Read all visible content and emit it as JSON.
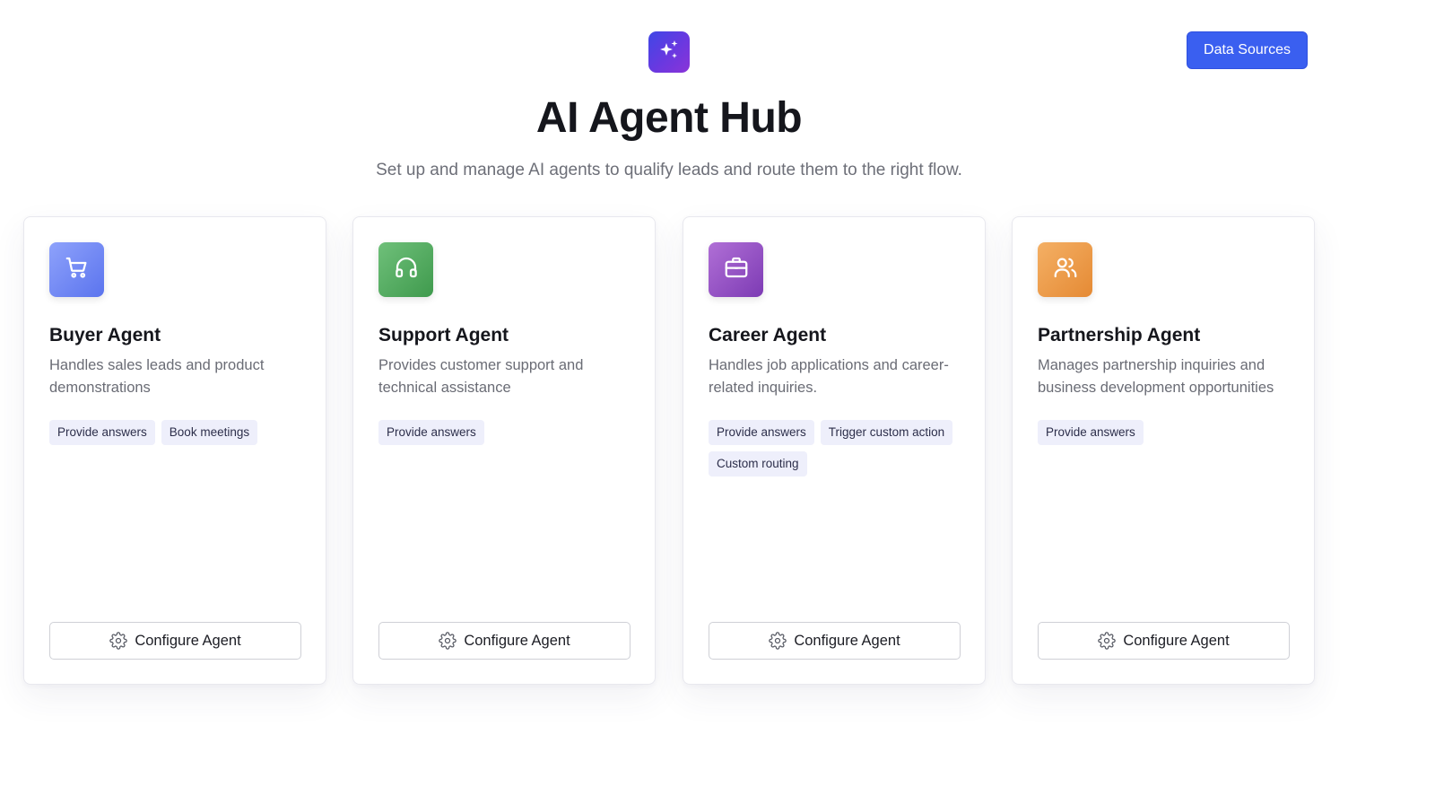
{
  "header": {
    "logo_icon": "sparkles-icon",
    "title": "AI Agent Hub",
    "subtitle": "Set up and manage AI agents to qualify leads and route them to the right flow.",
    "data_sources_label": "Data Sources"
  },
  "colors": {
    "accent": "#3a5ff0",
    "logo_gradient": [
      "#3f47e6",
      "#8a34d8"
    ],
    "tag_background": "#eeeffb"
  },
  "agents": [
    {
      "name": "Buyer Agent",
      "description": "Handles sales leads and product demonstrations",
      "icon": "shopping-cart-icon",
      "icon_colors": [
        "#8ea2fb",
        "#5b74ee"
      ],
      "tags": [
        "Provide answers",
        "Book meetings"
      ],
      "configure_label": "Configure Agent"
    },
    {
      "name": "Support Agent",
      "description": "Provides customer support and technical assistance",
      "icon": "headphones-icon",
      "icon_colors": [
        "#6fc07a",
        "#3f9a4d"
      ],
      "tags": [
        "Provide answers"
      ],
      "configure_label": "Configure Agent"
    },
    {
      "name": "Career Agent",
      "description": "Handles job applications and career-related inquiries.",
      "icon": "briefcase-icon",
      "icon_colors": [
        "#b06fd6",
        "#7d3bb4"
      ],
      "tags": [
        "Provide answers",
        "Trigger custom action",
        "Custom routing"
      ],
      "configure_label": "Configure Agent"
    },
    {
      "name": "Partnership Agent",
      "description": "Manages partnership inquiries and business development opportunities",
      "icon": "users-icon",
      "icon_colors": [
        "#f4b065",
        "#e58a34"
      ],
      "tags": [
        "Provide answers"
      ],
      "configure_label": "Configure Agent"
    }
  ]
}
